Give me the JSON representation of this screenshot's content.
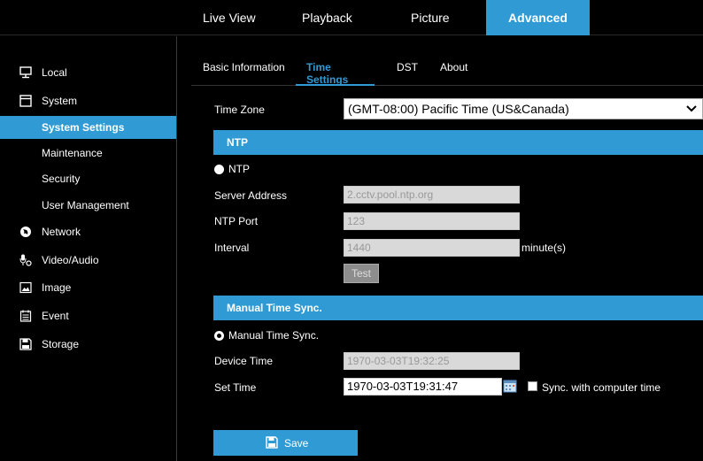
{
  "topnav": {
    "tabs": [
      {
        "label": "Live View"
      },
      {
        "label": "Playback"
      },
      {
        "label": "Picture"
      },
      {
        "label": "Advanced"
      }
    ]
  },
  "sidebar": {
    "items": [
      {
        "label": "Local",
        "icon": "monitor-icon"
      },
      {
        "label": "System",
        "icon": "window-icon"
      },
      {
        "label": "System Settings"
      },
      {
        "label": "Maintenance"
      },
      {
        "label": "Security"
      },
      {
        "label": "User Management"
      },
      {
        "label": "Network",
        "icon": "globe-icon"
      },
      {
        "label": "Video/Audio",
        "icon": "microphone-icon"
      },
      {
        "label": "Image",
        "icon": "image-icon"
      },
      {
        "label": "Event",
        "icon": "calendar-icon"
      },
      {
        "label": "Storage",
        "icon": "floppy-icon"
      }
    ]
  },
  "subtabs": [
    {
      "label": "Basic Information"
    },
    {
      "label": "Time Settings"
    },
    {
      "label": "DST"
    },
    {
      "label": "About"
    }
  ],
  "form": {
    "time_zone_label": "Time Zone",
    "time_zone_value": "(GMT-08:00) Pacific Time (US&Canada)",
    "ntp_section": "NTP",
    "ntp_radio_label": "NTP",
    "server_address_label": "Server Address",
    "server_address_value": "2.cctv.pool.ntp.org",
    "ntp_port_label": "NTP Port",
    "ntp_port_value": "123",
    "interval_label": "Interval",
    "interval_value": "1440",
    "interval_unit": "minute(s)",
    "test_label": "Test",
    "manual_section": "Manual Time Sync.",
    "manual_radio_label": "Manual Time Sync.",
    "device_time_label": "Device Time",
    "device_time_value": "1970-03-03T19:32:25",
    "set_time_label": "Set Time",
    "set_time_value": "1970-03-03T19:31:47",
    "sync_label": "Sync. with computer time",
    "save_label": "Save"
  },
  "colors": {
    "accent": "#2f9ad4",
    "background": "#000000"
  }
}
